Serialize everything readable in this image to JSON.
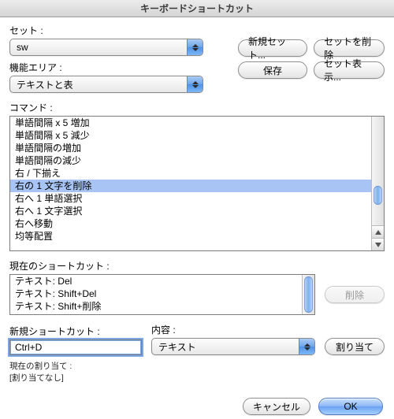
{
  "window": {
    "title": "キーボードショートカット"
  },
  "set": {
    "label": "セット :",
    "value": "sw"
  },
  "buttons": {
    "new_set": "新規セット...",
    "delete_set": "セットを削除",
    "save": "保存",
    "show_set": "セット表示...",
    "delete": "削除",
    "assign": "割り当て",
    "cancel": "キャンセル",
    "ok": "OK"
  },
  "area": {
    "label": "機能エリア :",
    "value": "テキストと表"
  },
  "commands": {
    "label": "コマンド :",
    "items": [
      "単語間隔 x 5 増加",
      "単語間隔 x 5 減少",
      "単語間隔の増加",
      "単語間隔の減少",
      "右 / 下揃え",
      "右の 1 文字を削除",
      "右へ 1 単語選択",
      "右へ 1 文字選択",
      "右へ移動",
      "均等配置"
    ],
    "selected_index": 5
  },
  "current": {
    "label": "現在のショートカット :",
    "items": [
      "テキスト: Del",
      "テキスト: Shift+Del",
      "テキスト: Shift+削除"
    ]
  },
  "new_shortcut": {
    "label": "新規ショートカット :",
    "value": "Ctrl+D"
  },
  "context": {
    "label": "内容 :",
    "value": "テキスト"
  },
  "assignment": {
    "label": "現在の割り当て :",
    "value": "[割り当てなし]"
  }
}
